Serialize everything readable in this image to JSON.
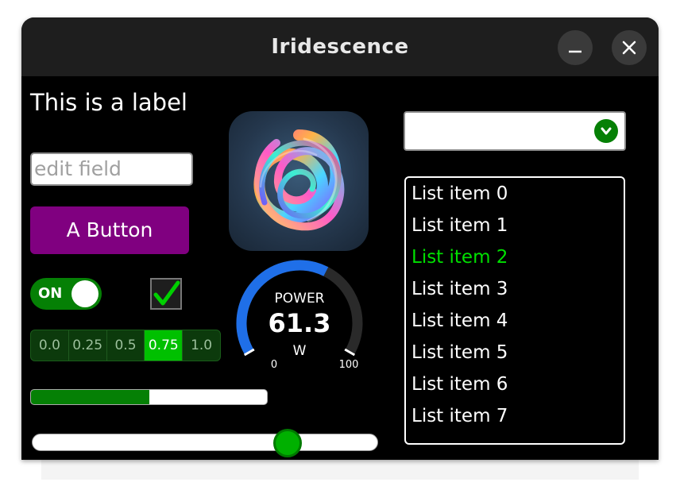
{
  "window": {
    "title": "Iridescence",
    "minimize_glyph": "_",
    "close_glyph": "✕"
  },
  "left": {
    "label": "This is a label",
    "edit_placeholder": "edit field",
    "button_label": "A Button",
    "toggle_label": "ON",
    "toggle_on": true,
    "checkbox_checked": true,
    "segments": [
      "0.0",
      "0.25",
      "0.5",
      "0.75",
      "1.0"
    ],
    "segment_selected_index": 3,
    "progress_fraction": 0.5,
    "slider_fraction": 0.74
  },
  "gauge": {
    "title": "POWER",
    "value": "61.3",
    "unit": "W",
    "min_label": "0",
    "max_label": "100",
    "min": 0,
    "max": 100,
    "numeric_value": 61.3
  },
  "dropdown": {
    "selected": ""
  },
  "list": {
    "items": [
      "List item 0",
      "List item 1",
      "List item 2",
      "List item 3",
      "List item 4",
      "List item 5",
      "List item 6",
      "List item 7"
    ],
    "selected_index": 2
  },
  "icons": {
    "minimize": "minimize-icon",
    "close": "close-icon",
    "dropdown": "chevron-down-icon",
    "checkbox": "checkmark-icon",
    "image": "iridescent-swirl-image"
  },
  "colors": {
    "accent_green": "#058005",
    "button_purple": "#800080",
    "gauge_blue": "#1f6fe8",
    "selected_list_item": "#00e000"
  }
}
